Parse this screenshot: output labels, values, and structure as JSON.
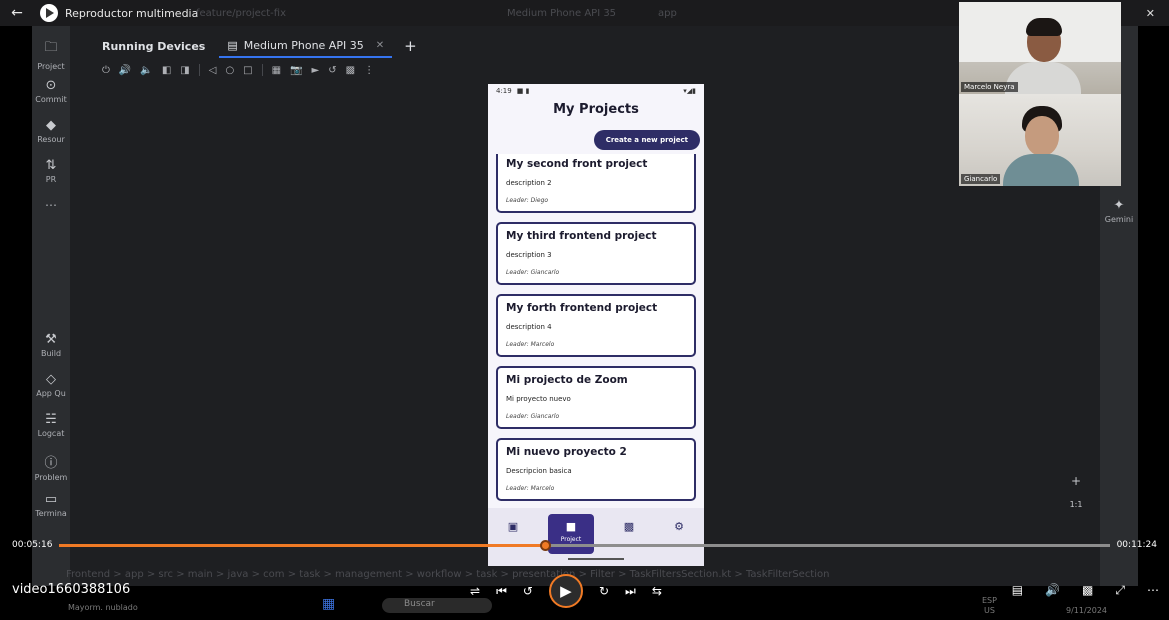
{
  "player": {
    "title": "Reproductor multimedia",
    "back_icon": "back-arrow-icon",
    "video_name": "video1660388106",
    "time_elapsed": "00:05:16",
    "time_total": "00:11:24",
    "progress": 0.462,
    "accent": "#f07a25"
  },
  "ide": {
    "branch": "feature/project-fix",
    "device_selector": "Medium Phone API 35",
    "run_config": "app",
    "tabs": {
      "running_devices": "Running Devices",
      "device_tab": "Medium Phone API 35"
    },
    "left_toolbar": [
      {
        "label": "Project",
        "icon": "folder-icon"
      },
      {
        "label": "Commit",
        "icon": "commit-icon"
      },
      {
        "label": "Resour",
        "icon": "resources-icon"
      },
      {
        "label": "PR",
        "icon": "pull-request-icon"
      },
      {
        "label": "Build",
        "icon": "hammer-icon"
      },
      {
        "label": "App Qu",
        "icon": "app-quality-icon"
      },
      {
        "label": "Logcat",
        "icon": "logcat-icon"
      },
      {
        "label": "Problem",
        "icon": "problems-icon"
      },
      {
        "label": "Termina",
        "icon": "terminal-icon"
      }
    ],
    "right_toolbar": {
      "gemini": "Gemini"
    },
    "breadcrumb": "Frontend > app > src > main > java > com > task > management > workflow > task > presentation > Filter > TaskFiltersSection.kt > TaskFilterSection",
    "zoom_label": "1:1"
  },
  "phone": {
    "status_time": "4:19",
    "app_title": "My Projects",
    "create_button": "Create a new project",
    "projects": [
      {
        "title": "My second front project",
        "description": "description 2",
        "leader": "Leader: Diego"
      },
      {
        "title": "My third frontend project",
        "description": "description 3",
        "leader": "Leader: Giancarlo"
      },
      {
        "title": "My forth frontend project",
        "description": "description 4",
        "leader": "Leader: Marcelo"
      },
      {
        "title": "Mi projecto de Zoom",
        "description": "Mi proyecto nuevo",
        "leader": "Leader: Giancarlo"
      },
      {
        "title": "Mi nuevo proyecto 2",
        "description": "Descripcion basica",
        "leader": "Leader: Marcelo"
      }
    ],
    "nav": {
      "active_label": "Project"
    }
  },
  "participants": [
    {
      "name": "Marcelo Neyra"
    },
    {
      "name": "Giancarlo"
    }
  ],
  "taskbar": {
    "search_placeholder": "Buscar",
    "weather": "Mayorm. nublado",
    "language": "ESP",
    "region": "US",
    "date": "9/11/2024"
  }
}
